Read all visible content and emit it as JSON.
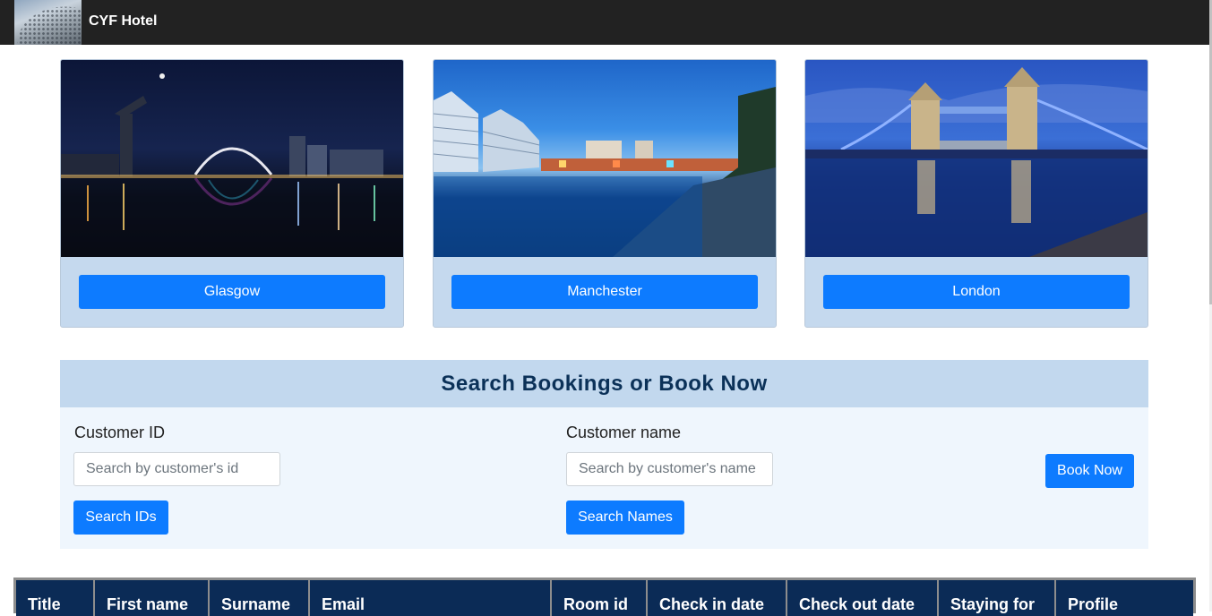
{
  "navbar": {
    "brand": "CYF Hotel"
  },
  "cities": [
    {
      "label": "Glasgow"
    },
    {
      "label": "Manchester"
    },
    {
      "label": "London"
    }
  ],
  "search": {
    "title": "Search Bookings or Book Now",
    "customer_id_label": "Customer ID",
    "customer_id_placeholder": "Search by customer's id",
    "search_ids_button": "Search IDs",
    "customer_name_label": "Customer name",
    "customer_name_placeholder": "Search by customer's name",
    "search_names_button": "Search Names",
    "book_now_button": "Book Now"
  },
  "table": {
    "headers": [
      "Title",
      "First name",
      "Surname",
      "Email",
      "Room id",
      "Check in date",
      "Check out date",
      "Staying for",
      "Profile"
    ]
  },
  "colors": {
    "accent": "#0d7bff",
    "header_bg": "#0b2b56",
    "navbar": "#222222"
  }
}
